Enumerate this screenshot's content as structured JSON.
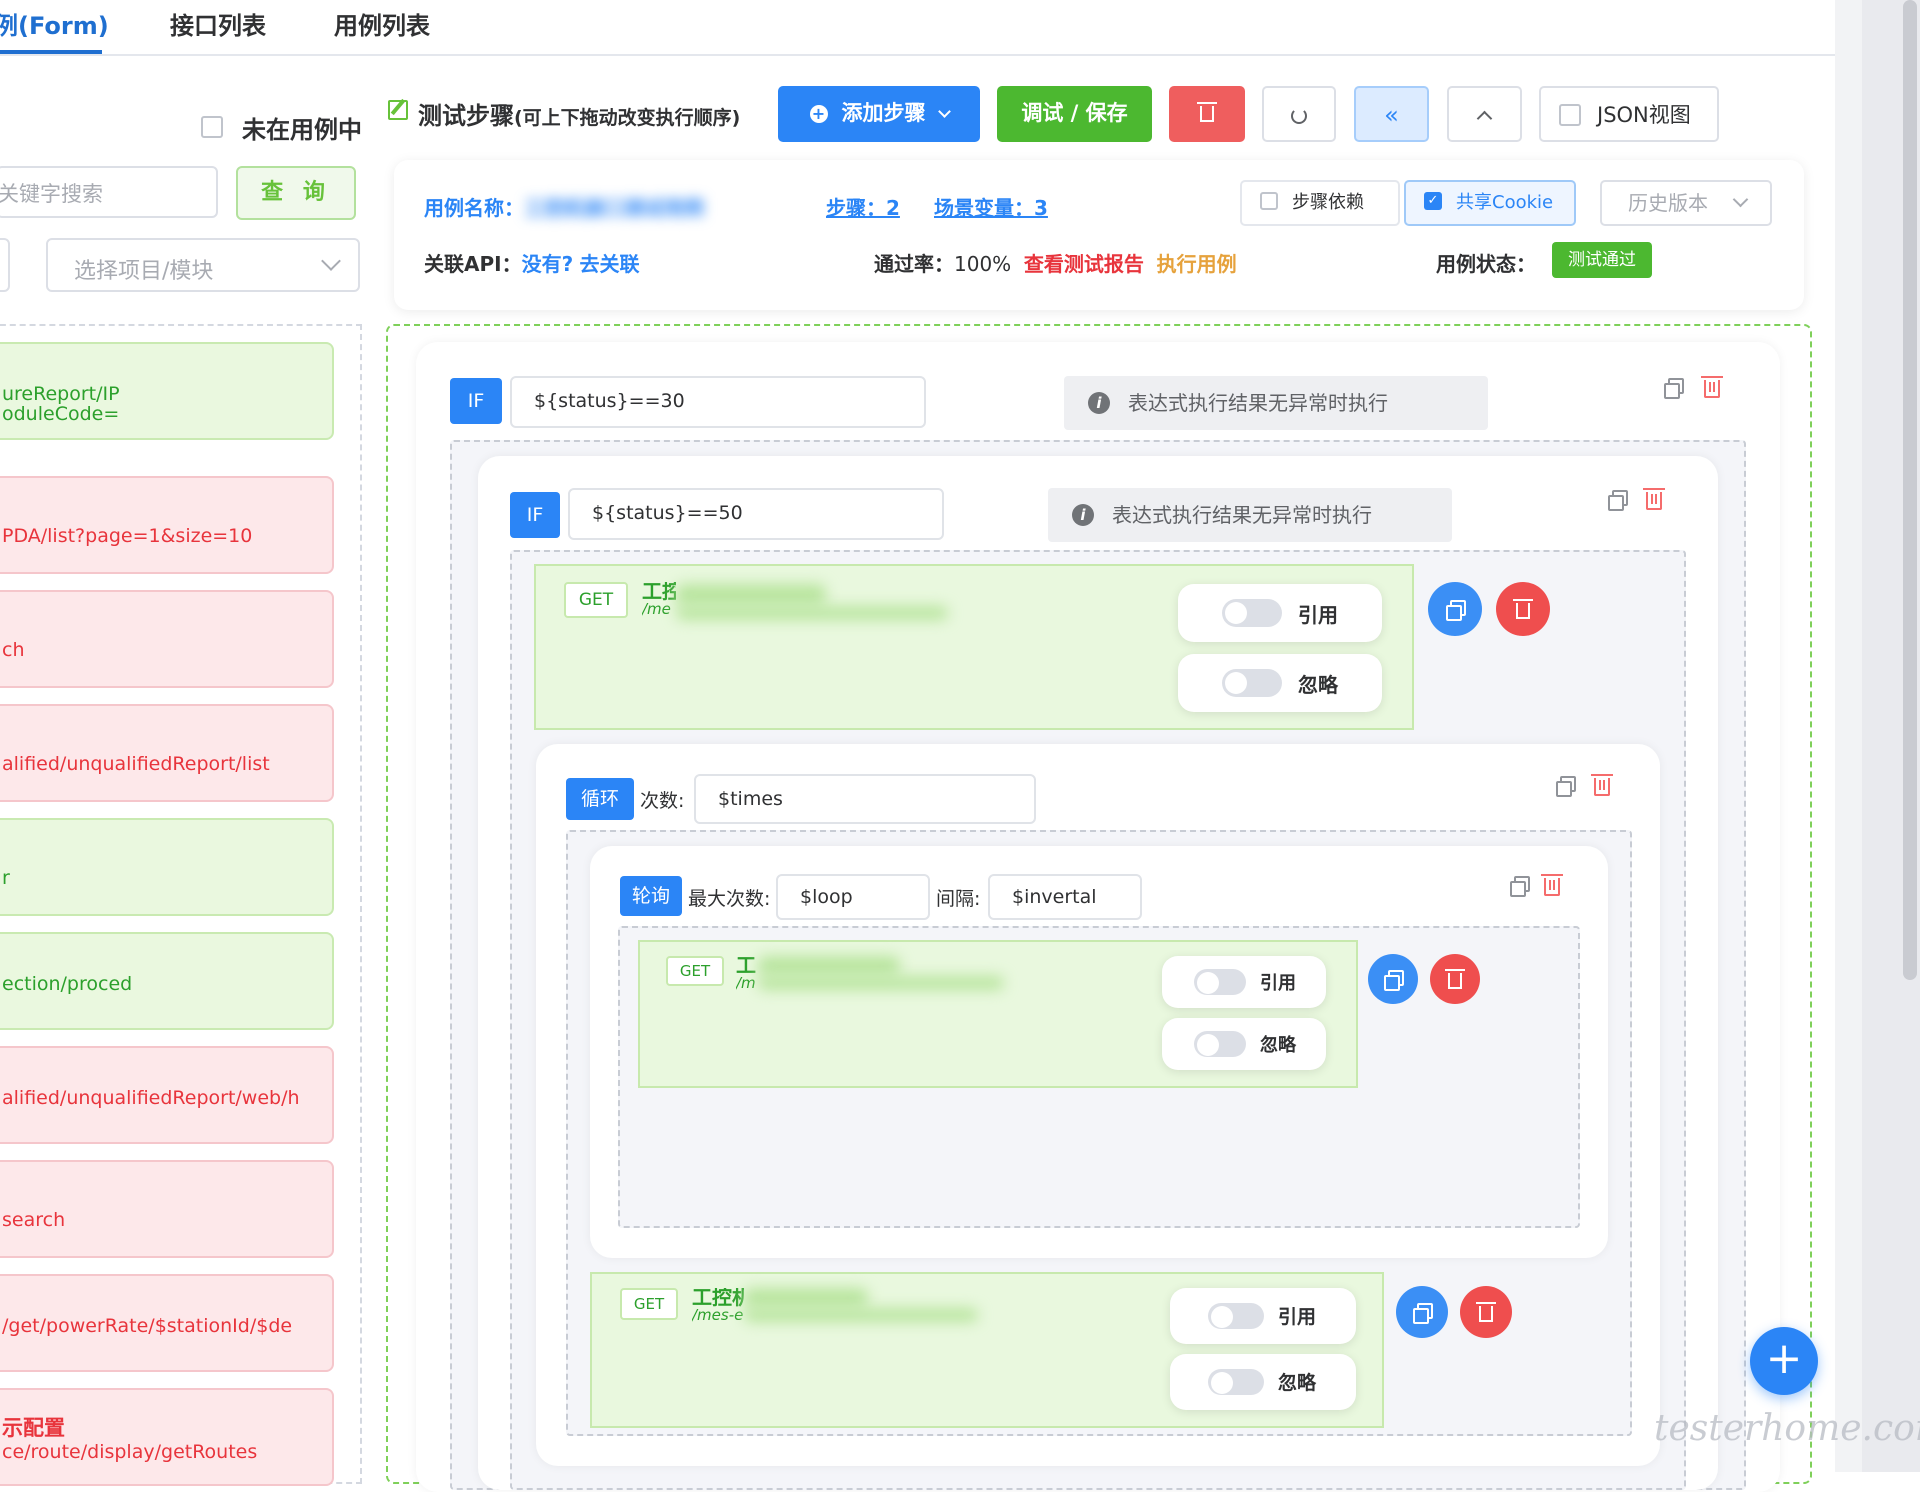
{
  "tabs": [
    "例(Form)",
    "接口列表",
    "用例列表"
  ],
  "left": {
    "not_in_case_label": "未在用例中",
    "search_placeholder": "关键字搜索",
    "query_button": "查 询",
    "select_placeholder": "选择项目/模块",
    "api_items": [
      {
        "line1": "ureReport/IP",
        "line2": "oduleCode=",
        "status": "green"
      },
      {
        "line1": "PDA/list?page=1&size=10",
        "line2": "",
        "status": "red"
      },
      {
        "line1": "ch",
        "line2": "",
        "status": "red"
      },
      {
        "line1": "alified/unqualifiedReport/list",
        "line2": "",
        "status": "red"
      },
      {
        "line1": "r",
        "line2": "",
        "status": "green"
      },
      {
        "line1": "ection/proced",
        "line2": "",
        "status": "green"
      },
      {
        "line1": "alified/unqualifiedReport/web/h",
        "line2": "",
        "status": "red"
      },
      {
        "line1": "search",
        "line2": "",
        "status": "red"
      },
      {
        "line1": "/get/powerRate/$stationId/$de",
        "line2": "",
        "status": "red"
      },
      {
        "line1": "示配置",
        "line2": "ce/route/display/getRoutes",
        "status": "red"
      }
    ]
  },
  "toolbar": {
    "title": "测试步骤",
    "title_hint": "(可上下拖动改变执行顺序)",
    "add_step": "添加步骤",
    "debug_save": "调试 / 保存",
    "json_view": "JSON视图"
  },
  "info": {
    "case_name_label": "用例名称：",
    "case_name_value": "工控机接口测试用例",
    "steps_label": "步骤：",
    "steps_count": "2",
    "scene_var_label": "场景变量：",
    "scene_var_count": "3",
    "step_dep": "步骤依赖",
    "share_cookie": "共享Cookie",
    "history": "历史版本",
    "related_api_label": "关联API：",
    "related_api_none": "没有?",
    "related_api_link": "去关联",
    "pass_rate_label": "通过率：",
    "pass_rate_value": "100%",
    "view_report": "查看测试报告",
    "run_case": "执行用例",
    "status_label": "用例状态：",
    "status_value": "测试通过"
  },
  "steps": {
    "if_tag": "IF",
    "if1_expr": "${status}==30",
    "if2_expr": "${status}==50",
    "if_hint": "表达式执行结果无异常时执行",
    "loop_tag": "循环",
    "loop_times_label": "次数:",
    "loop_times_value": "$times",
    "poll_tag": "轮询",
    "poll_max_label": "最大次数:",
    "poll_max_value": "$loop",
    "poll_interval_label": "间隔:",
    "poll_interval_value": "$invertal",
    "get_method": "GET",
    "api1_name": "工控",
    "api1_path": "/me",
    "api2_name": "工",
    "api2_path": "/m",
    "api3_name": "工控机",
    "api3_path": "/mes-e",
    "ref_label": "引用",
    "ignore_label": "忽略"
  },
  "watermark": "testerhome.com",
  "colors": {
    "primary": "#2b85f6",
    "success": "#4cb830",
    "danger": "#ef5e5e",
    "warning": "#e6a23c"
  }
}
